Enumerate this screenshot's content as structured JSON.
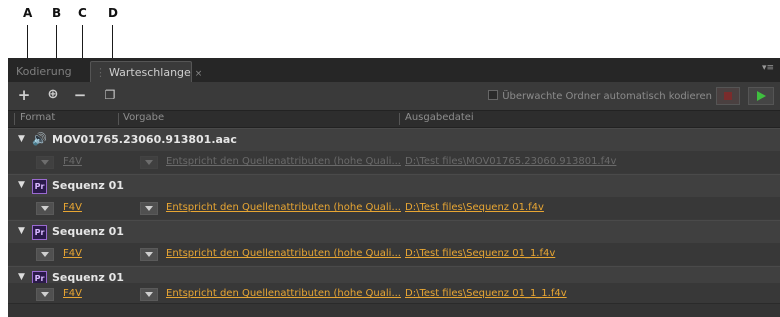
{
  "callouts": [
    "A",
    "B",
    "C",
    "D"
  ],
  "tabs": {
    "encoding": "Kodierung",
    "queue": "Warteschlange",
    "close": "×"
  },
  "panel_menu": "▾≡",
  "toolbar": {
    "add_icon": "+",
    "add_preset_icon": "⊕",
    "remove_icon": "−",
    "duplicate_icon": "❐",
    "watch_label": "Überwachte Ordner automatisch kodieren"
  },
  "columns": {
    "format": "Format",
    "preset": "Vorgabe",
    "output": "Ausgabedatei"
  },
  "sources": [
    {
      "type": "audio",
      "name": "MOV01765.23060.913801.aac",
      "outputs": [
        {
          "format": "F4V",
          "preset": "Entspricht den Quellenattributen (hohe Quali...",
          "file": "D:\\Test files\\MOV01765.23060.913801.f4v",
          "disabled": true
        }
      ]
    },
    {
      "type": "premiere",
      "badge": "Pr",
      "name": "Sequenz 01",
      "outputs": [
        {
          "format": "F4V",
          "preset": "Entspricht den Quellenattributen (hohe Quali...",
          "file": "D:\\Test files\\Sequenz 01.f4v",
          "disabled": false
        }
      ]
    },
    {
      "type": "premiere",
      "badge": "Pr",
      "name": "Sequenz 01",
      "outputs": [
        {
          "format": "F4V",
          "preset": "Entspricht den Quellenattributen (hohe Quali...",
          "file": "D:\\Test files\\Sequenz 01_1.f4v",
          "disabled": false
        }
      ]
    },
    {
      "type": "premiere",
      "badge": "Pr",
      "name": "Sequenz 01",
      "outputs": [
        {
          "format": "F4V",
          "preset": "Entspricht den Quellenattributen (hohe Quali...",
          "file": "D:\\Test files\\Sequenz 01_1_1.f4v",
          "disabled": false
        }
      ]
    }
  ],
  "colors": {
    "link": "#e8a633",
    "play": "#3fbf3f",
    "stop": "#7a2c2c",
    "panel": "#3a3a3a"
  }
}
